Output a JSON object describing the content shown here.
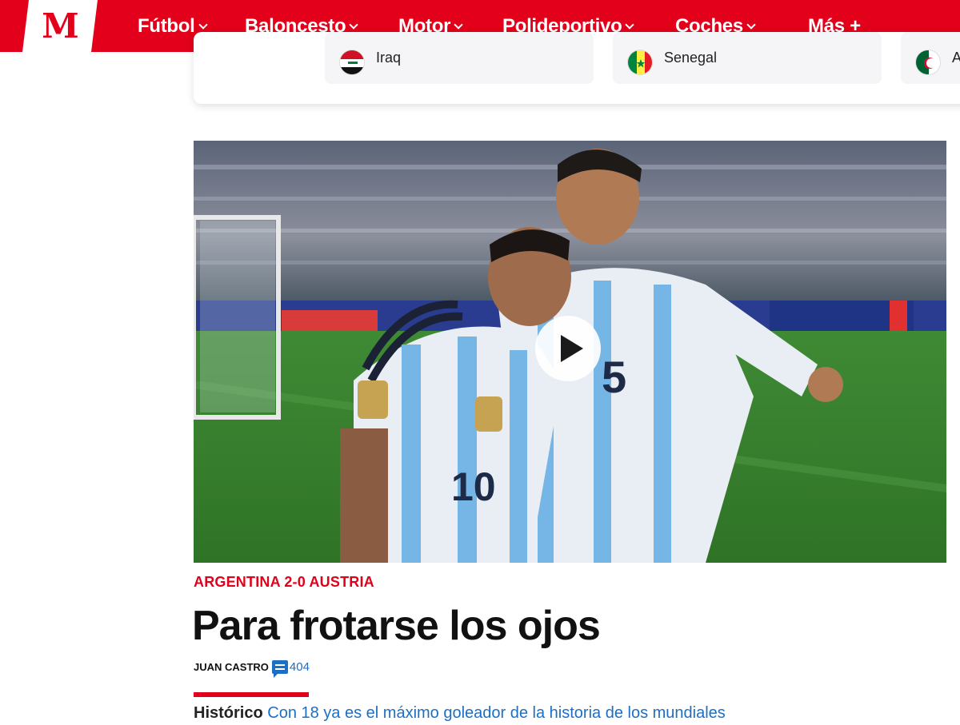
{
  "brand": {
    "logo_text": "M",
    "accent_color": "#e2001a",
    "link_color": "#1d6fc4"
  },
  "nav": {
    "items": [
      {
        "label": "Fútbol",
        "has_dropdown": true
      },
      {
        "label": "Baloncesto",
        "has_dropdown": true
      },
      {
        "label": "Motor",
        "has_dropdown": true
      },
      {
        "label": "Polideportivo",
        "has_dropdown": true
      },
      {
        "label": "Coches",
        "has_dropdown": true
      },
      {
        "label": "Más +",
        "has_dropdown": false
      }
    ]
  },
  "groups": {
    "teams": [
      {
        "name": "Iraq",
        "flag_icon": "iraq-flag-icon"
      },
      {
        "name": "Senegal",
        "flag_icon": "senegal-flag-icon"
      },
      {
        "name": "A",
        "flag_icon": "algeria-flag-icon"
      }
    ]
  },
  "article": {
    "media_type": "video",
    "kicker": "ARGENTINA 2-0 AUSTRIA",
    "headline": "Para frotarse los ojos",
    "author": "JUAN CASTRO",
    "comments": "404",
    "related_label": "Histórico",
    "related_link": "Con 18 ya es el máximo goleador de la historia de los mundiales"
  }
}
